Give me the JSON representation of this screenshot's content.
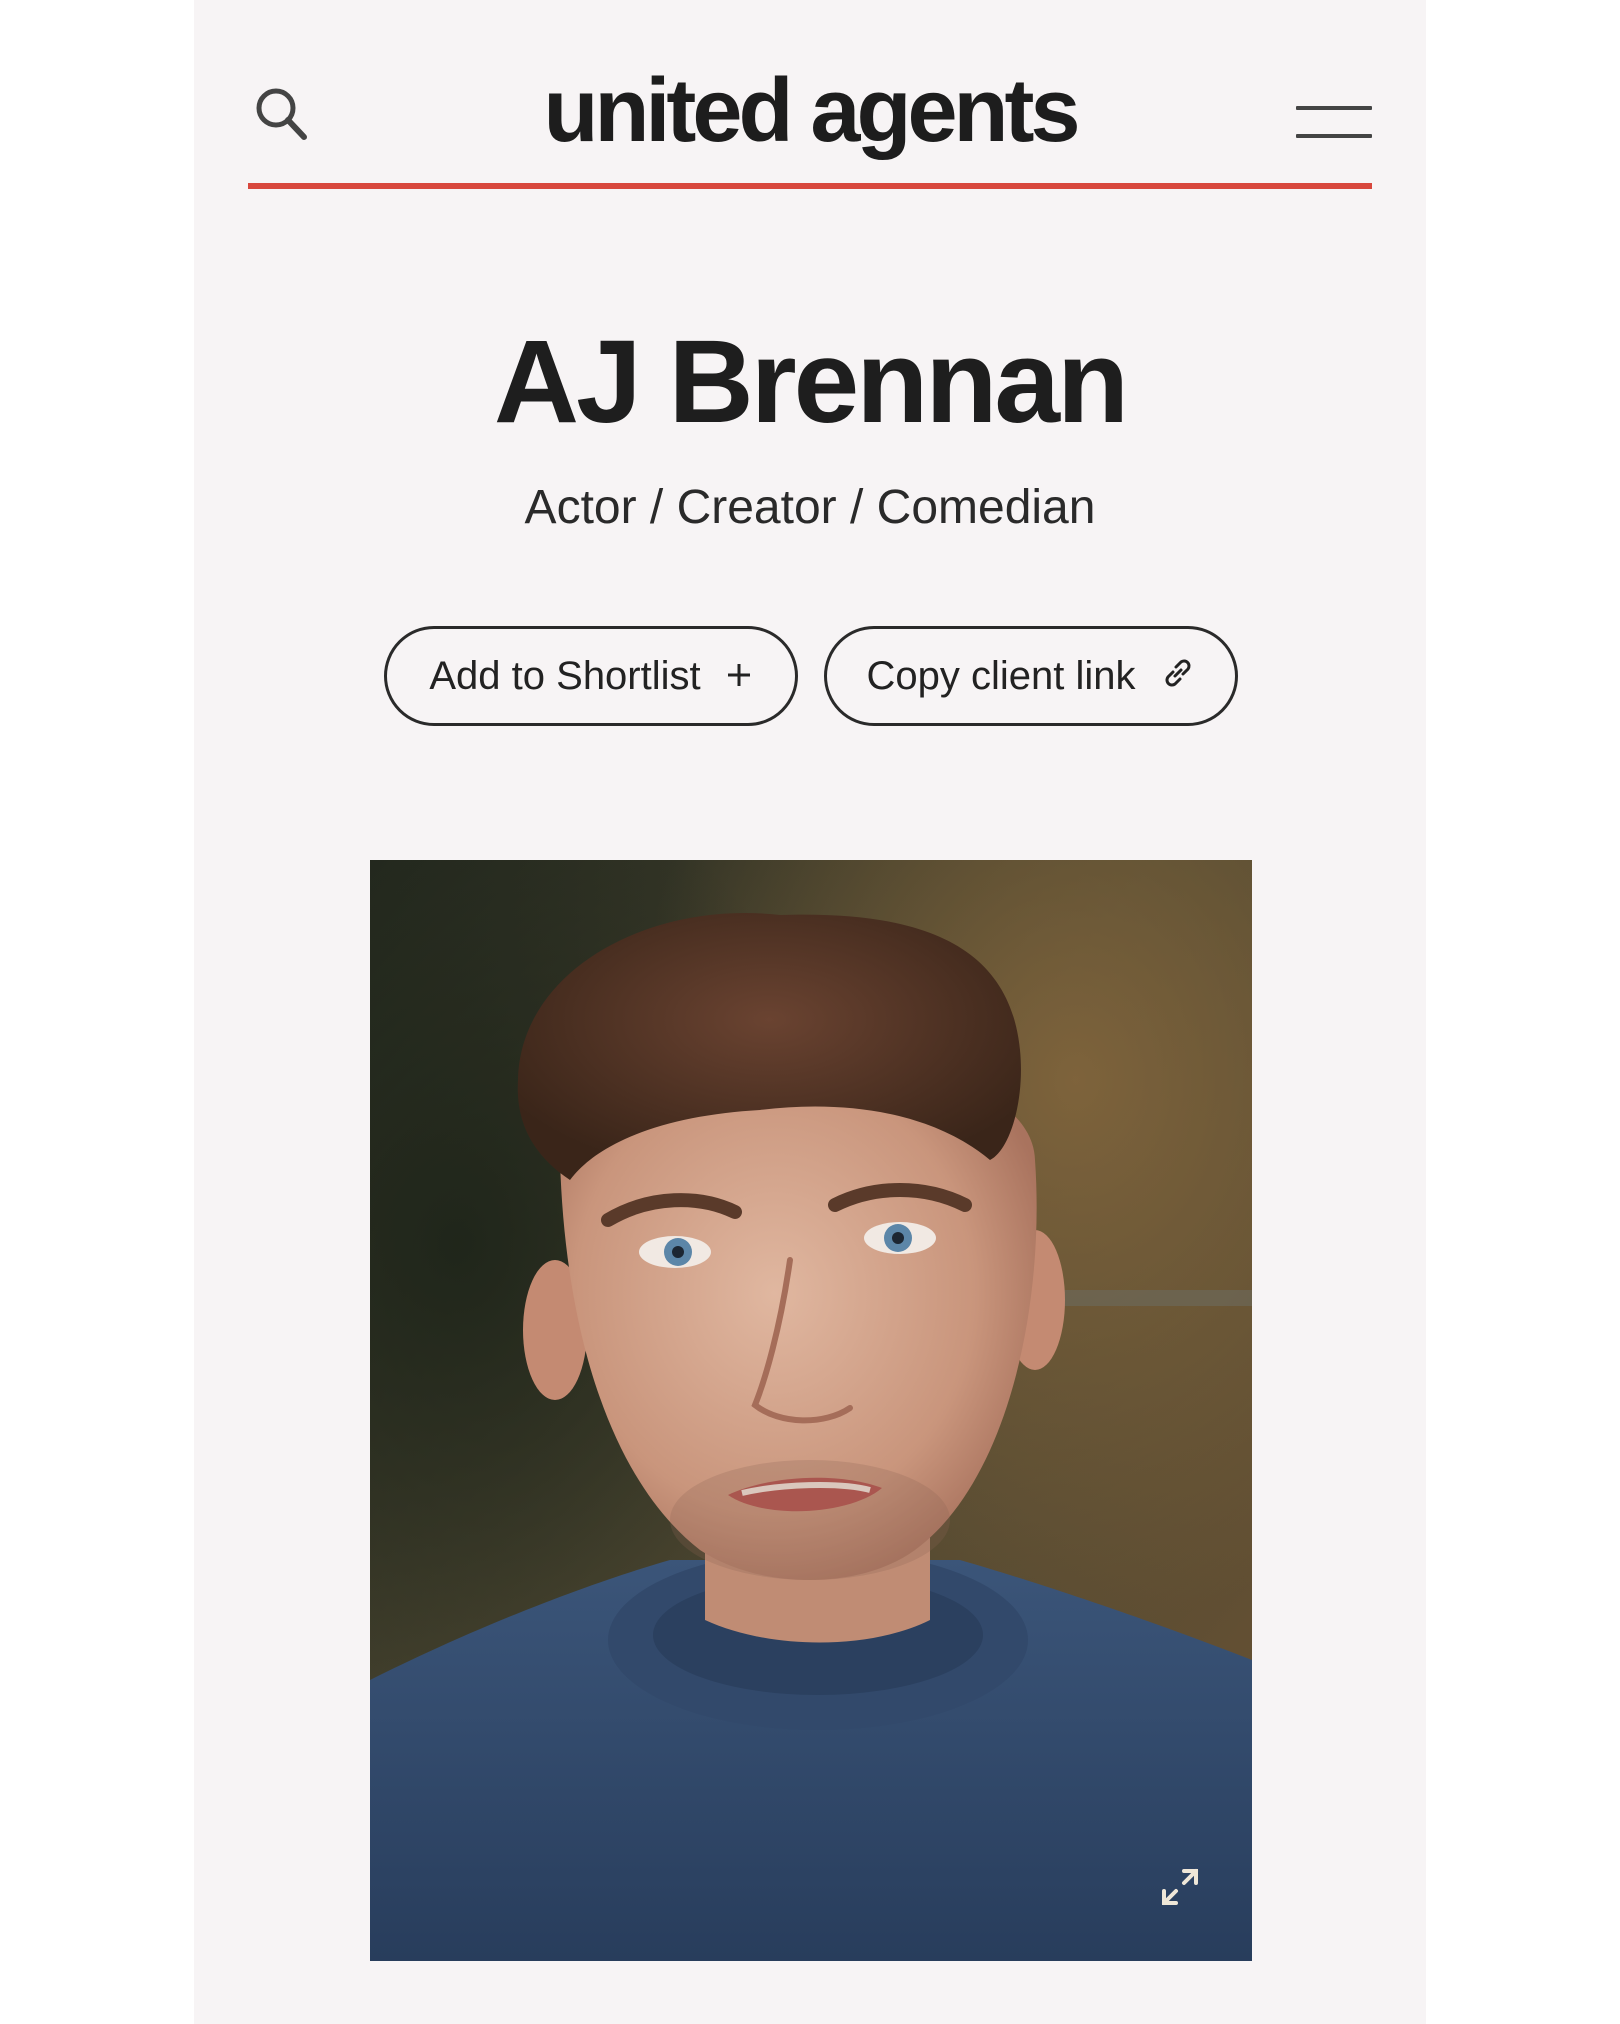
{
  "header": {
    "logo_text": "united agents",
    "search_icon": "search-icon",
    "menu_icon": "hamburger-menu-icon",
    "accent_color": "#d8473d"
  },
  "profile": {
    "name": "AJ Brennan",
    "roles": "Actor / Creator / Comedian"
  },
  "actions": {
    "shortlist_label": "Add to Shortlist",
    "shortlist_icon": "plus-icon",
    "copy_label": "Copy client link",
    "copy_icon": "link-icon"
  },
  "photo": {
    "subject": "headshot-photo",
    "expand_icon": "expand-icon"
  }
}
